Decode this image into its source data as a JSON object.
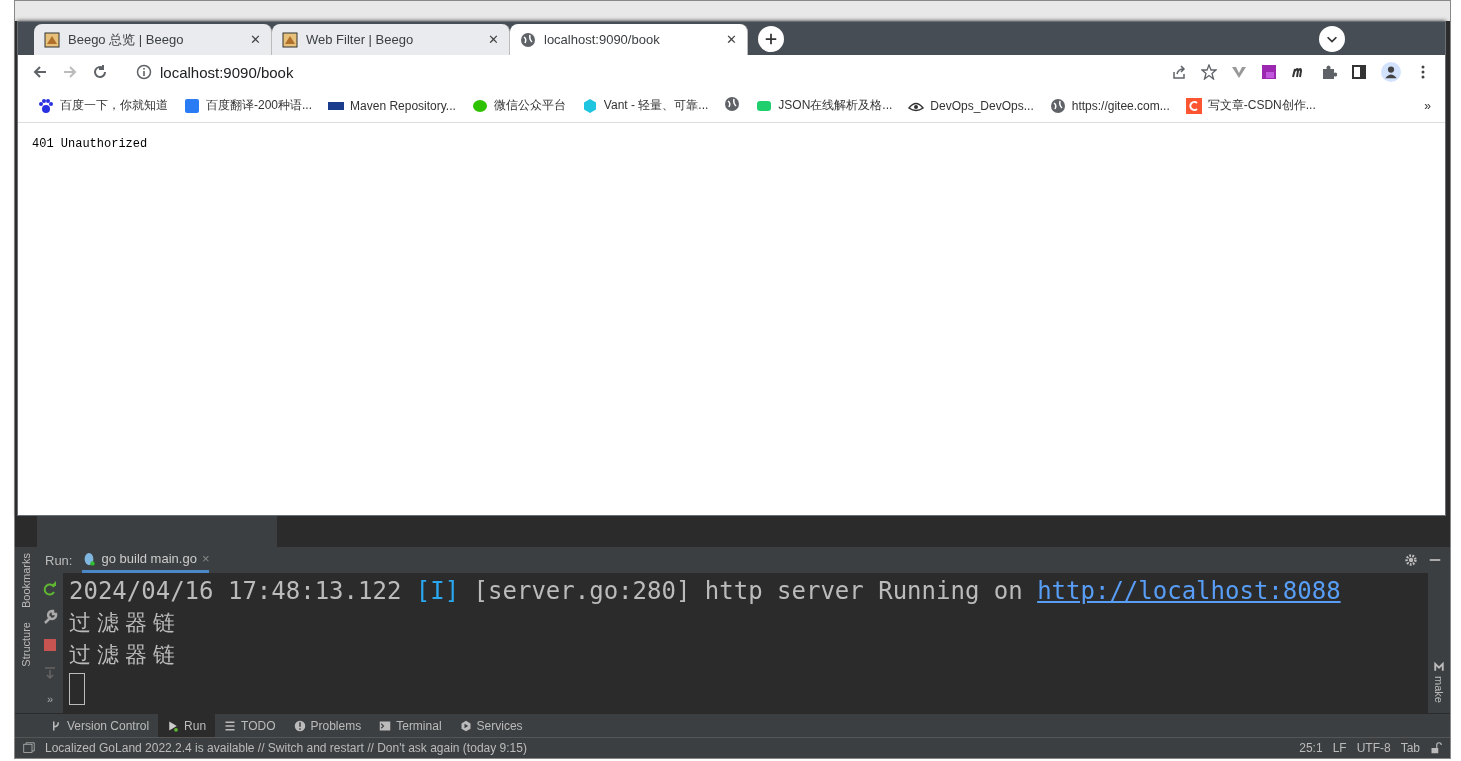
{
  "browser": {
    "tabs": [
      {
        "title": "Beego 总览 | Beego",
        "kind": "logo",
        "close": "✕",
        "selected": false
      },
      {
        "title": "Web Filter | Beego",
        "kind": "logo",
        "close": "✕",
        "selected": false
      },
      {
        "title": "localhost:9090/book",
        "kind": "globe",
        "close": "✕",
        "selected": true
      }
    ],
    "address": "localhost:9090/book",
    "bookmarks": [
      {
        "label": "百度一下，你就知道",
        "kind": "paw"
      },
      {
        "label": "百度翻译-200种语...",
        "kind": "square"
      },
      {
        "label": "Maven Repository...",
        "kind": "bar"
      },
      {
        "label": "微信公众平台",
        "kind": "chat"
      },
      {
        "label": "Vant - 轻量、可靠...",
        "kind": "hex"
      },
      {
        "kind": "globe"
      },
      {
        "label": "JSON在线解析及格...",
        "kind": "pill"
      },
      {
        "label": "DevOps_DevOps...",
        "kind": "eye"
      },
      {
        "label": "https://gitee.com...",
        "kind": "globe"
      },
      {
        "label": "写文章-CSDN创作...",
        "kind": "csdn"
      }
    ],
    "more_bookmarks": "»",
    "content": "401 Unauthorized"
  },
  "ide": {
    "side_tabs": [
      "Bookmarks",
      "Structure"
    ],
    "right_tab": "make",
    "run_label": "Run:",
    "run_tab": "go build main.go",
    "run_tab_close": "×",
    "more_tools": "»",
    "log": {
      "time": "2024/04/16 17:48:13.122",
      "level": "[I]",
      "source": "[server.go:280]",
      "message": "http server Running on",
      "link": "http://localhost:8088"
    },
    "lines": [
      "过滤器链",
      "过滤器链"
    ],
    "tool_tabs": [
      {
        "label": "Version Control",
        "kind": "branch",
        "selected": false
      },
      {
        "label": "Run",
        "kind": "play",
        "selected": true
      },
      {
        "label": "TODO",
        "kind": "list",
        "selected": false
      },
      {
        "label": "Problems",
        "kind": "alert",
        "selected": false
      },
      {
        "label": "Terminal",
        "kind": "terminal",
        "selected": false
      },
      {
        "label": "Services",
        "kind": "services",
        "selected": false
      }
    ],
    "status": {
      "message": "Localized GoLand 2022.2.4 is available // Switch and restart // Don't ask again (today 9:15)",
      "items": [
        "25:1",
        "LF",
        "UTF-8",
        "Tab"
      ]
    }
  }
}
